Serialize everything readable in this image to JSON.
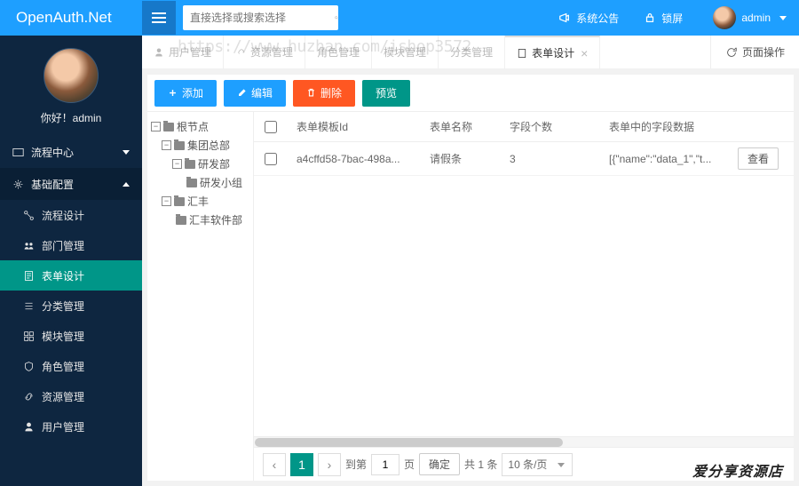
{
  "header": {
    "brand": "OpenAuth.Net",
    "search_placeholder": "直接选择或搜索选择",
    "announce": "系统公告",
    "lock": "锁屏",
    "user": "admin"
  },
  "sidebar": {
    "greeting": "你好！admin",
    "groups": [
      {
        "label": "流程中心",
        "open": false
      },
      {
        "label": "基础配置",
        "open": true
      }
    ],
    "items": [
      {
        "label": "流程设计"
      },
      {
        "label": "部门管理"
      },
      {
        "label": "表单设计",
        "active": true
      },
      {
        "label": "分类管理"
      },
      {
        "label": "模块管理"
      },
      {
        "label": "角色管理"
      },
      {
        "label": "资源管理"
      },
      {
        "label": "用户管理"
      }
    ]
  },
  "tabs": {
    "items": [
      {
        "label": "用户管理"
      },
      {
        "label": "资源管理"
      },
      {
        "label": "角色管理"
      },
      {
        "label": "模块管理"
      },
      {
        "label": "分类管理"
      },
      {
        "label": "表单设计",
        "active": true
      }
    ],
    "page_ops": "页面操作"
  },
  "watermark": "https://www.huzhan.com/ishop3572",
  "toolbar": {
    "add": "添加",
    "edit": "编辑",
    "del": "删除",
    "preview": "预览"
  },
  "tree": [
    {
      "label": "根节点",
      "depth": 0,
      "toggle": "-"
    },
    {
      "label": "集团总部",
      "depth": 1,
      "toggle": "-"
    },
    {
      "label": "研发部",
      "depth": 2,
      "toggle": "-"
    },
    {
      "label": "研发小组",
      "depth": 3,
      "toggle": ""
    },
    {
      "label": "汇丰",
      "depth": 1,
      "toggle": "-"
    },
    {
      "label": "汇丰软件部",
      "depth": 2,
      "toggle": ""
    }
  ],
  "table": {
    "headers": {
      "id": "表单模板Id",
      "name": "表单名称",
      "count": "字段个数",
      "data": "表单中的字段数据"
    },
    "rows": [
      {
        "id": "a4cffd58-7bac-498a...",
        "name": "请假条",
        "count": "3",
        "data": "[{\"name\":\"data_1\",\"t...",
        "action": "查看"
      }
    ]
  },
  "pager": {
    "page": "1",
    "goto_prefix": "到第",
    "goto_page": "1",
    "goto_suffix": "页",
    "confirm": "确定",
    "total": "共 1 条",
    "pagesize": "10 条/页"
  },
  "corner": "爱分享资源店"
}
